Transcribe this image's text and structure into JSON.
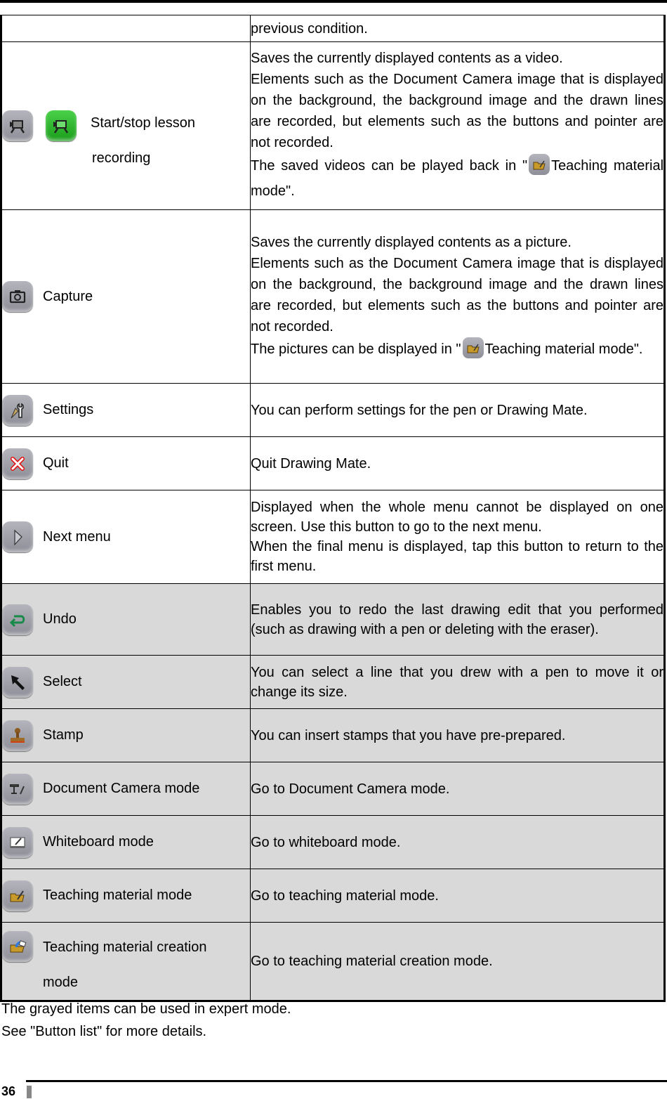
{
  "rows": [
    {
      "name": "",
      "desc": [
        "previous condition."
      ],
      "gray": false
    },
    {
      "name_line1": "Start/stop lesson",
      "name_line2": "recording",
      "icons": [
        "video-record-icon-gray",
        "video-record-icon-green"
      ],
      "desc": [
        "Saves the currently displayed contents as a video.",
        "Elements such as the Document Camera image that is displayed on the background, the background image and the drawn lines are recorded, but elements such as the buttons and pointer are not recorded.",
        "The saved videos can be played back in \"",
        "Teaching material mode\"."
      ],
      "gray": false
    },
    {
      "name": "Capture",
      "icon": "camera-icon",
      "desc": [
        "Saves the currently displayed contents as a picture.",
        "Elements such as the Document Camera image that is displayed on the background, the background image and the drawn lines are recorded, but elements such as the buttons and pointer are not recorded.",
        "The pictures can be displayed in \"",
        "Teaching material mode\"."
      ],
      "gray": false
    },
    {
      "name": "Settings",
      "icon": "settings-wrench-pen-icon",
      "desc": [
        "You can perform settings for the pen or Drawing Mate."
      ],
      "gray": false
    },
    {
      "name": "Quit",
      "icon": "quit-x-icon",
      "desc": [
        "Quit Drawing Mate."
      ],
      "gray": false
    },
    {
      "name": "Next menu",
      "icon": "next-arrow-icon",
      "desc": [
        "Displayed when the whole menu cannot be displayed on one screen. Use this button to go to the next menu.",
        "When the final menu is displayed, tap this button to return to the first menu."
      ],
      "gray": false
    },
    {
      "name": "Undo",
      "icon": "undo-arrow-icon",
      "desc": [
        "Enables you to redo the last drawing edit that you performed (such as drawing with a pen or deleting with the eraser)."
      ],
      "gray": true
    },
    {
      "name": "Select",
      "icon": "select-pointer-icon",
      "desc": [
        "You can select a line that you drew with a pen to move it or change its size."
      ],
      "gray": true
    },
    {
      "name": "Stamp",
      "icon": "stamp-icon",
      "desc": [
        "You can insert stamps that you have pre-prepared."
      ],
      "gray": true
    },
    {
      "name": "Document Camera mode",
      "icon": "document-camera-icon",
      "desc": [
        "Go to Document Camera mode."
      ],
      "gray": true
    },
    {
      "name": "Whiteboard mode",
      "icon": "whiteboard-icon",
      "desc": [
        "Go to whiteboard mode."
      ],
      "gray": true
    },
    {
      "name": "Teaching material mode",
      "icon": "teaching-material-folder-icon",
      "desc": [
        "Go to teaching material mode."
      ],
      "gray": true
    },
    {
      "name_line1": "Teaching material creation",
      "name_line2": "mode",
      "icon": "teaching-material-creation-icon",
      "desc": [
        "Go to teaching material creation mode."
      ],
      "gray": true
    }
  ],
  "footnotes": [
    "The grayed items can be used in expert mode.",
    "See \"Button list\" for more details."
  ],
  "page_number": "36",
  "colors": {
    "gray_row": "#d9d9d9",
    "record_green": "#2ab82a",
    "undo_green": "#1a8a4a",
    "quit_red": "#e01010"
  }
}
